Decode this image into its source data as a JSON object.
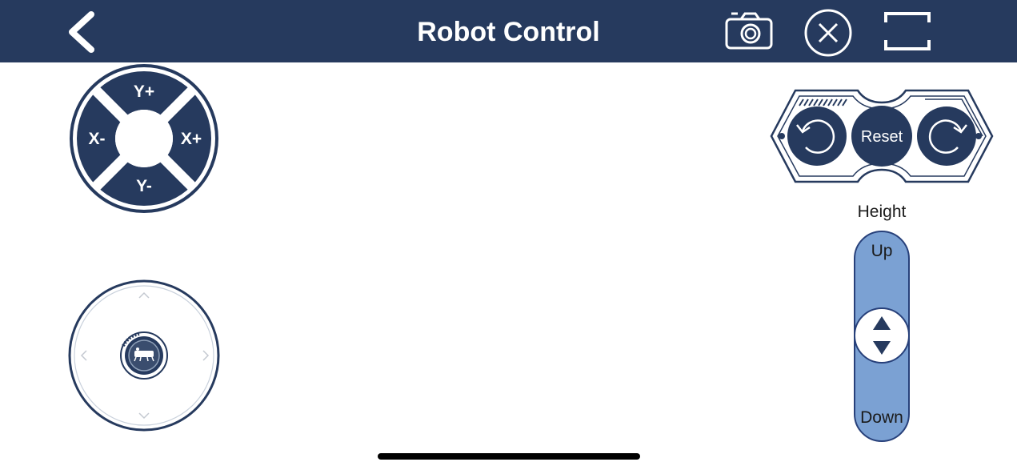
{
  "header": {
    "title": "Robot Control",
    "background": "#263a5e",
    "icons": {
      "back": "chevron-left-icon",
      "camera": "camera-icon",
      "close": "close-circle-icon",
      "fullscreen": "fullscreen-icon"
    }
  },
  "dpad": {
    "up_label": "Y+",
    "down_label": "Y-",
    "left_label": "X-",
    "right_label": "X+",
    "color": "#263a5e"
  },
  "joystick": {
    "icon": "robot-icon"
  },
  "rotation": {
    "reset_label": "Reset",
    "rotate_left_icon": "rotate-counterclockwise-icon",
    "rotate_right_icon": "rotate-clockwise-icon"
  },
  "height": {
    "title": "Height",
    "up_label": "Up",
    "down_label": "Down",
    "track_color": "#7ba1d3"
  }
}
